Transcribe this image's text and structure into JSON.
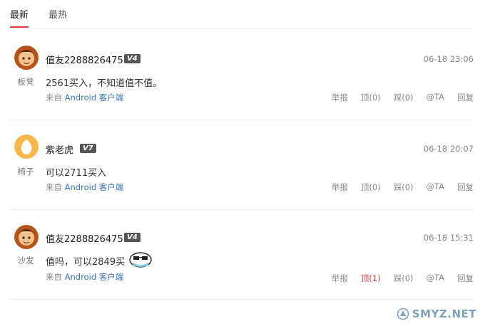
{
  "tabs": [
    {
      "label": "最新",
      "active": true
    },
    {
      "label": "最热",
      "active": false
    }
  ],
  "comments": [
    {
      "username": "值友2288826475",
      "level": "V4",
      "time": "06-18 23:06",
      "floor": "板凳",
      "text": "2561买入，不知道值不值。",
      "source_prefix": "来自",
      "source_app": "Android",
      "source_suffix": "客户端",
      "actions": {
        "report": "举报",
        "up": "顶(0)",
        "down": "踩(0)",
        "at": "@TA",
        "reply": "回复"
      },
      "up_highlight": false
    },
    {
      "username": "紫老虎",
      "level": "V7",
      "time": "06-18 20:07",
      "floor": "椅子",
      "text": "可以2711买入",
      "source_prefix": "来自",
      "source_app": "Android",
      "source_suffix": "客户端",
      "actions": {
        "report": "举报",
        "up": "顶(0)",
        "down": "踩(0)",
        "at": "@TA",
        "reply": "回复"
      },
      "up_highlight": false
    },
    {
      "username": "值友2288826475",
      "level": "V4",
      "time": "06-18 15:31",
      "floor": "沙发",
      "text": "值吗，可以2849买",
      "source_prefix": "来自",
      "source_app": "Android",
      "source_suffix": "客户端",
      "actions": {
        "report": "举报",
        "up": "顶(1)",
        "down": "踩(0)",
        "at": "@TA",
        "reply": "回复"
      },
      "up_highlight": true
    }
  ],
  "watermark": "SMYZ.NET",
  "colors": {
    "accent": "#e4393c",
    "link": "#3b74b4",
    "level_badge": "#555555"
  }
}
